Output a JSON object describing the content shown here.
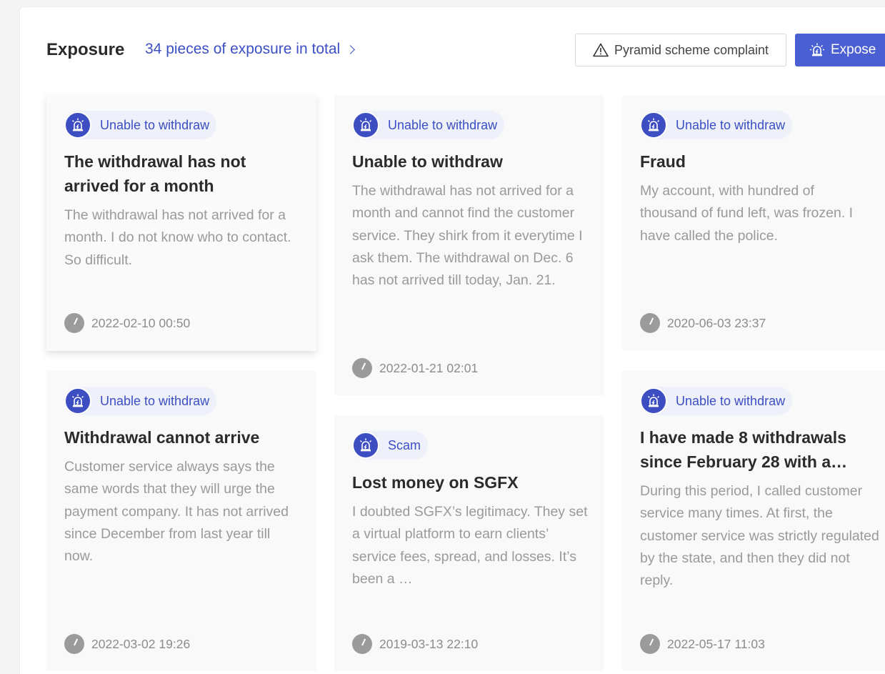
{
  "header": {
    "title": "Exposure",
    "total_link": "34 pieces of exposure in total",
    "complaint_button": "Pyramid scheme complaint",
    "expose_button": "Expose"
  },
  "colors": {
    "accent": "#4a5fd1",
    "link": "#3c4fc4",
    "tag_bg": "#eef0fa"
  },
  "cards": [
    {
      "tag": "Unable to withdraw",
      "title": "The withdrawal has not arrived for a month",
      "body": "The withdrawal has not arrived for a month. I do not know who to contact. So difficult.",
      "date": "2022-02-10 00:50"
    },
    {
      "tag": "Unable to withdraw",
      "title": "Unable to withdraw",
      "body": "The withdrawal has not arrived for a month and cannot find the customer service. They shirk from it everytime I ask them. The withdrawal on Dec. 6 has not arrived till today, Jan. 21.",
      "date": "2022-01-21 02:01"
    },
    {
      "tag": "Unable to withdraw",
      "title": "Fraud",
      "body": "My account, with hundred of thousand of fund left, was frozen. I have called the police.",
      "date": "2020-06-03 23:37"
    },
    {
      "tag": "Unable to withdraw",
      "title": "Withdrawal cannot arrive",
      "body": "Customer service always says the same words that they will urge the payment company. It has not arrived since December from last year till now.",
      "date": "2022-03-02 19:26"
    },
    {
      "tag": "Scam",
      "title": "Lost money on SGFX",
      "body": "I doubted SGFX’s legitimacy. They set a virtual platform to earn clients’ service fees, spread, and losses. It’s been a …",
      "date": "2019-03-13 22:10"
    },
    {
      "tag": "Unable to withdraw",
      "title": "I have made 8 withdrawals since February 28 with a…",
      "body": "During this period, I called customer service many times. At first, the customer service was strictly regulated by the state, and then they did not reply.",
      "date": "2022-05-17 11:03"
    }
  ]
}
